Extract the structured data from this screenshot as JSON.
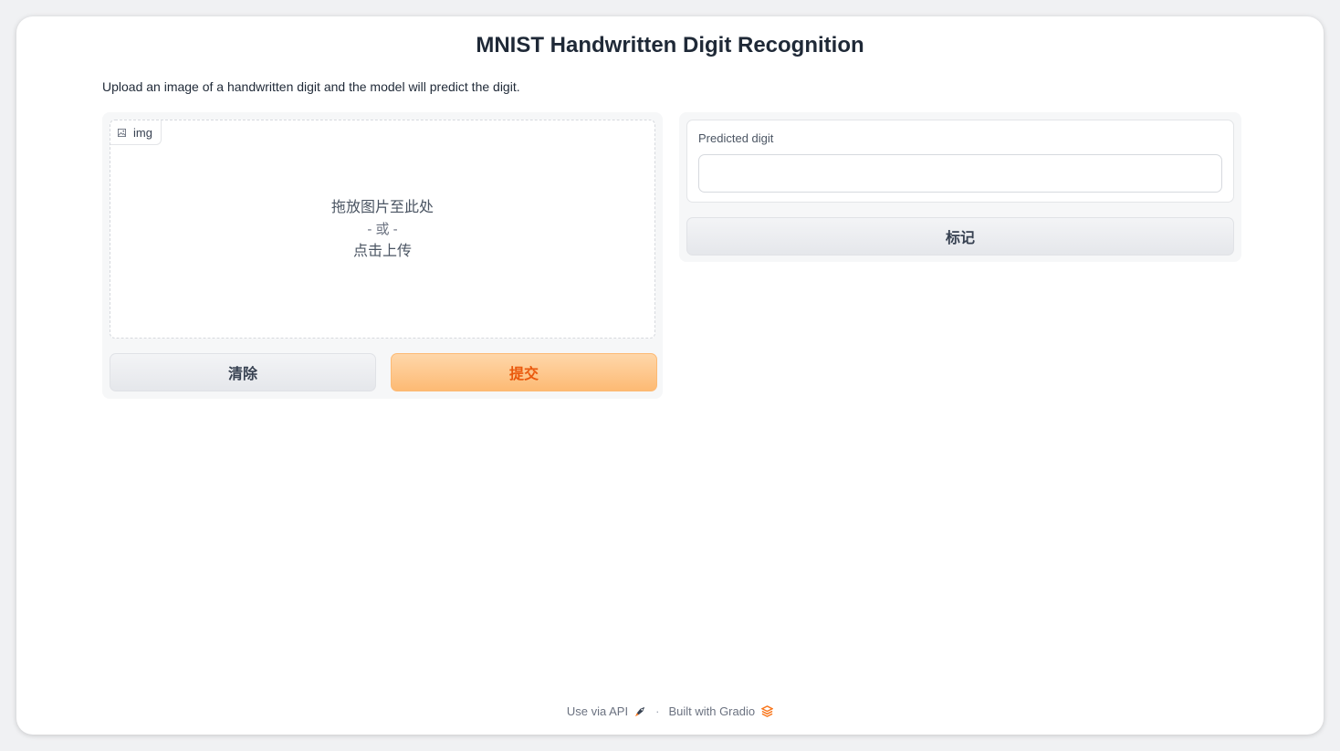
{
  "app": {
    "title": "MNIST Handwritten Digit Recognition",
    "description": "Upload an image of a handwritten digit and the model will predict the digit."
  },
  "input": {
    "label": "img",
    "label_icon": "image-icon",
    "drop_line1": "拖放图片至此处",
    "drop_line2": "- 或 -",
    "drop_line3": "点击上传"
  },
  "buttons": {
    "clear": "清除",
    "submit": "提交",
    "flag": "标记"
  },
  "output": {
    "label": "Predicted digit",
    "value": ""
  },
  "footer": {
    "api_label": "Use via API",
    "api_icon": "rocket-icon",
    "separator": "·",
    "built_label": "Built with Gradio",
    "built_icon": "gradio-logo-icon"
  },
  "colors": {
    "accent": "#ea580c",
    "submit_bg": "#fdba74",
    "panel_bg": "#f6f7f8"
  }
}
